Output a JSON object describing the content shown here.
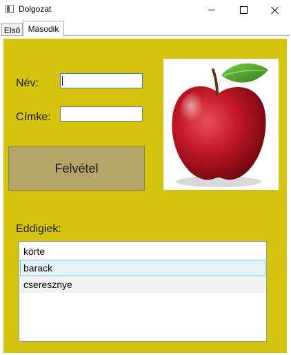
{
  "window": {
    "title": "Dolgozat"
  },
  "tabs": [
    {
      "label": "Első",
      "active": false
    },
    {
      "label": "Második",
      "active": true
    }
  ],
  "form": {
    "name_label": "Név:",
    "name_value": "",
    "tag_label": "Címke:",
    "tag_value": "",
    "add_button_label": "Felvétel",
    "list_label": "Eddigiek:"
  },
  "list": {
    "items": [
      "körte",
      "barack",
      "cseresznye"
    ],
    "selected_index": 1
  },
  "image": {
    "subject": "red apple with a green leaf",
    "icon": "apple-image"
  },
  "colors": {
    "panel_background": "#d4c410",
    "button_background": "#b5a566",
    "selection_background": "#e5f3fb"
  }
}
